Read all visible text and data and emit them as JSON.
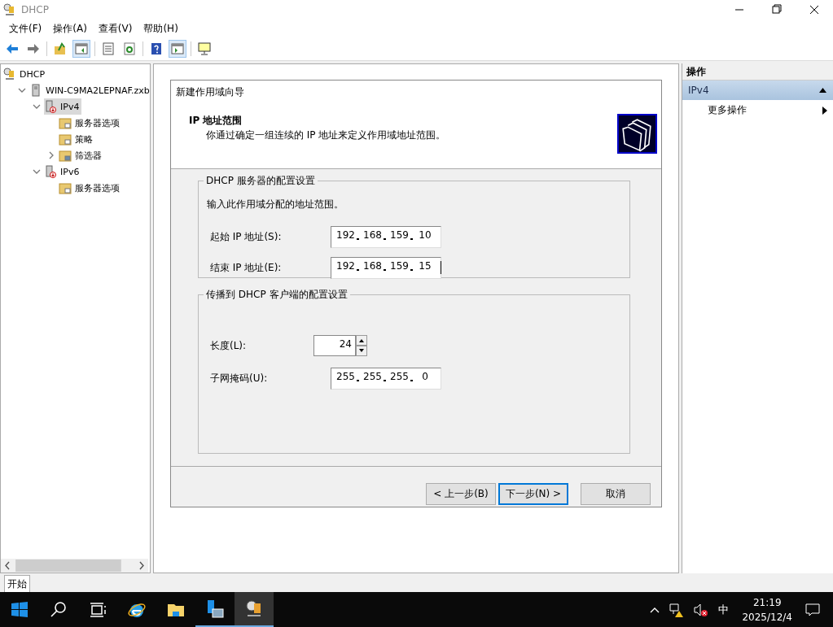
{
  "window": {
    "title": "DHCP"
  },
  "menu": [
    "文件(F)",
    "操作(A)",
    "查看(V)",
    "帮助(H)"
  ],
  "toolbar": [
    {
      "kind": "back",
      "selected": false
    },
    {
      "kind": "forward",
      "selected": false
    },
    {
      "kind": "sep"
    },
    {
      "kind": "up",
      "selected": false
    },
    {
      "kind": "panel-left",
      "selected": true
    },
    {
      "kind": "sep"
    },
    {
      "kind": "list",
      "selected": false
    },
    {
      "kind": "refresh",
      "selected": false
    },
    {
      "kind": "sep"
    },
    {
      "kind": "help",
      "selected": false
    },
    {
      "kind": "panel-right",
      "selected": true
    },
    {
      "kind": "sep"
    },
    {
      "kind": "monitor",
      "selected": false
    }
  ],
  "tree": [
    {
      "label": "DHCP",
      "kind": "dhcp",
      "children": [
        {
          "label": "WIN-C9MA2LEPNAF.zxb",
          "kind": "server",
          "expanded": true,
          "selected": false,
          "children": [
            {
              "label": "IPv4",
              "kind": "protocol",
              "expanded": true,
              "selected": true,
              "children": [
                {
                  "label": "服务器选项",
                  "kind": "folder",
                  "selected": false
                },
                {
                  "label": "策略",
                  "kind": "policy",
                  "selected": false
                },
                {
                  "label": "筛选器",
                  "kind": "filter",
                  "expanded": false,
                  "selected": false
                }
              ]
            },
            {
              "label": "IPv6",
              "kind": "protocol",
              "expanded": true,
              "selected": false,
              "children": [
                {
                  "label": "服务器选项",
                  "kind": "folder",
                  "selected": false
                }
              ]
            }
          ]
        }
      ]
    }
  ],
  "actions": {
    "header": "操作",
    "section": "IPv4",
    "items": [
      "更多操作"
    ]
  },
  "dialog": {
    "title": "新建作用域向导",
    "heading": "IP 地址范围",
    "subheading": "你通过确定一组连续的 IP 地址来定义作用域地址范围。",
    "groups": [
      {
        "legend": "DHCP 服务器的配置设置",
        "intro": "输入此作用域分配的地址范围。",
        "fields": [
          {
            "kind": "ip",
            "label": "起始 IP 地址(S):",
            "octets": [
              "192",
              "168",
              "159",
              "10"
            ],
            "caret": false
          },
          {
            "kind": "ip",
            "label": "结束 IP 地址(E):",
            "octets": [
              "192",
              "168",
              "159",
              "15"
            ],
            "caret": true
          }
        ]
      },
      {
        "legend": "传播到 DHCP 客户端的配置设置",
        "fields": [
          {
            "kind": "spin",
            "label": "长度(L):",
            "value": "24"
          },
          {
            "kind": "ip",
            "label": "子网掩码(U):",
            "octets": [
              "255",
              "255",
              "255",
              "0"
            ],
            "caret": false
          }
        ]
      }
    ],
    "buttons": [
      {
        "label": "< 上一步(B)",
        "default": false
      },
      {
        "label": "下一步(N) >",
        "default": true
      },
      {
        "label": "取消",
        "default": false
      }
    ]
  },
  "tabs": [
    {
      "label": "开始",
      "selected": true
    }
  ],
  "taskbar": {
    "items": [
      {
        "kind": "start",
        "running": false,
        "active": false
      },
      {
        "kind": "search",
        "running": false,
        "active": false
      },
      {
        "kind": "taskview",
        "running": false,
        "active": false
      },
      {
        "kind": "ie",
        "running": false,
        "active": false
      },
      {
        "kind": "explorer",
        "running": false,
        "active": false
      },
      {
        "kind": "servermanager",
        "running": true,
        "active": false
      },
      {
        "kind": "dhcp",
        "running": true,
        "active": true
      }
    ],
    "ime": "中",
    "time": "21:19",
    "date": "2025/12/4"
  }
}
